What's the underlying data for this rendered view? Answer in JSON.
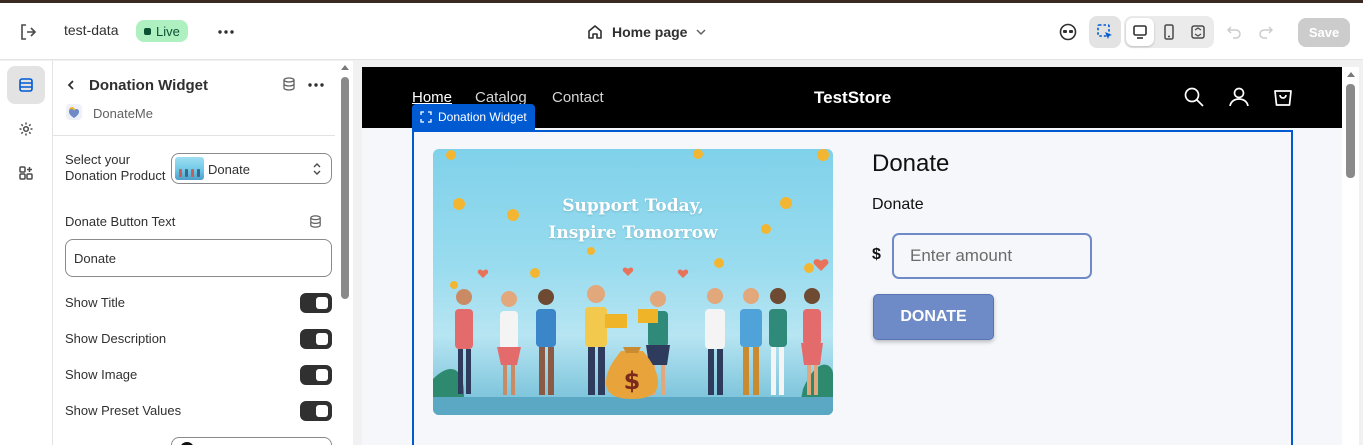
{
  "topbar": {
    "store_name": "test-data",
    "status_badge": "Live",
    "page_selector": "Home page",
    "save_label": "Save"
  },
  "rail": {
    "items": [
      {
        "icon": "sections-icon",
        "active": true
      },
      {
        "icon": "settings-gear-icon",
        "active": false
      },
      {
        "icon": "apps-icon",
        "active": false
      }
    ]
  },
  "panel": {
    "title": "Donation Widget",
    "app_name": "DonateMe",
    "product_label": "Select your Donation Product",
    "product_value": "Donate",
    "button_text_label": "Donate Button Text",
    "button_text_value": "Donate",
    "toggles": [
      {
        "label": "Show Title",
        "on": true
      },
      {
        "label": "Show Description",
        "on": true
      },
      {
        "label": "Show Image",
        "on": true
      },
      {
        "label": "Show Preset Values",
        "on": true
      }
    ]
  },
  "preview": {
    "nav": [
      "Home",
      "Catalog",
      "Contact"
    ],
    "store_logo": "TestStore",
    "widget_tag": "Donation Widget",
    "hero_line1": "Support Today,",
    "hero_line2": "Inspire Tomorrow",
    "donate_title": "Donate",
    "donate_description": "Donate",
    "currency_symbol": "$",
    "amount_placeholder": "Enter amount",
    "donate_button": "DONATE"
  },
  "colors": {
    "accent_blue": "#005bd3",
    "donate_button": "#6f8bc7",
    "live_badge_bg": "#aff0c1",
    "live_badge_text": "#0c5132"
  }
}
